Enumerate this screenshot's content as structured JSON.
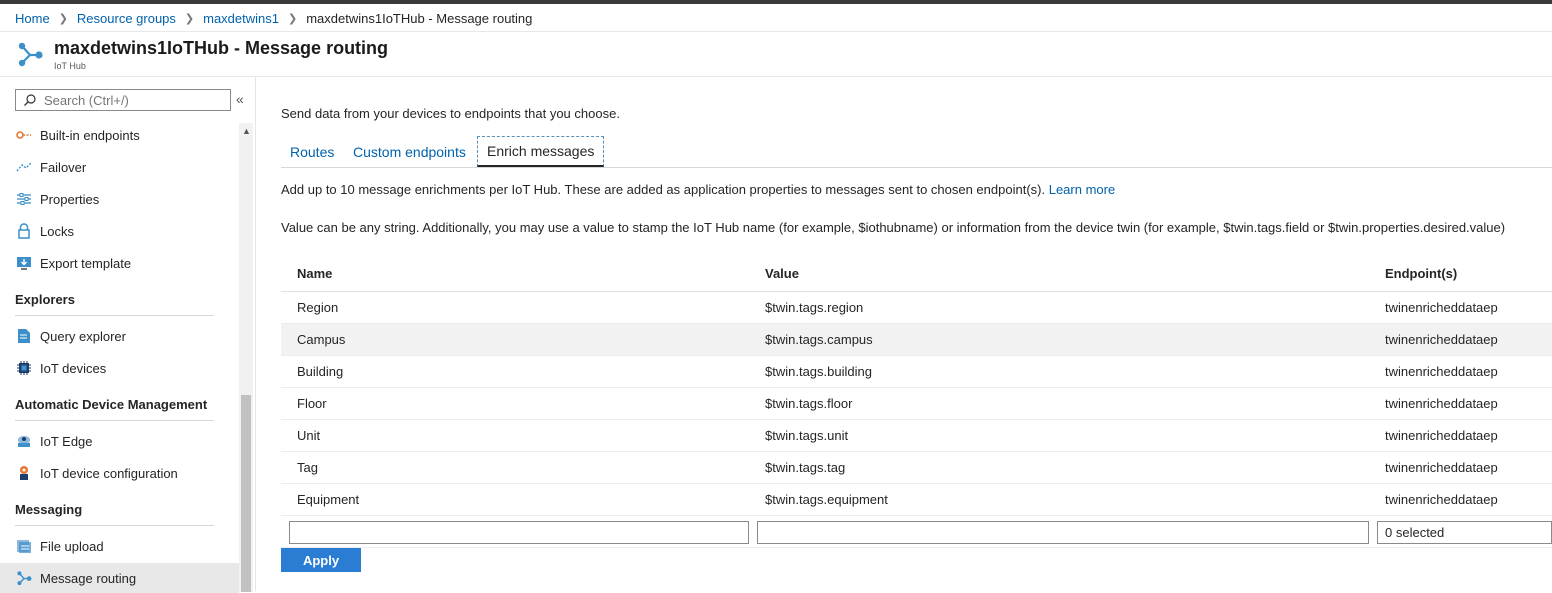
{
  "breadcrumb": {
    "items": [
      "Home",
      "Resource groups",
      "maxdetwins1"
    ],
    "current": "maxdetwins1IoTHub - Message routing"
  },
  "header": {
    "title": "maxdetwins1IoTHub - Message routing",
    "subtitle": "IoT Hub"
  },
  "sidebar": {
    "search_placeholder": "Search (Ctrl+/)",
    "items": [
      {
        "label": "Built-in endpoints",
        "icon": "endpoint-icon"
      },
      {
        "label": "Failover",
        "icon": "failover-icon"
      },
      {
        "label": "Properties",
        "icon": "properties-icon"
      },
      {
        "label": "Locks",
        "icon": "lock-icon"
      },
      {
        "label": "Export template",
        "icon": "export-template-icon"
      }
    ],
    "sections": [
      {
        "title": "Explorers",
        "items": [
          {
            "label": "Query explorer",
            "icon": "query-explorer-icon"
          },
          {
            "label": "IoT devices",
            "icon": "iot-devices-icon"
          }
        ]
      },
      {
        "title": "Automatic Device Management",
        "items": [
          {
            "label": "IoT Edge",
            "icon": "iot-edge-icon"
          },
          {
            "label": "IoT device configuration",
            "icon": "device-configuration-icon"
          }
        ]
      },
      {
        "title": "Messaging",
        "items": [
          {
            "label": "File upload",
            "icon": "file-upload-icon"
          },
          {
            "label": "Message routing",
            "icon": "message-routing-icon"
          }
        ]
      }
    ]
  },
  "main": {
    "intro": "Send data from your devices to endpoints that you choose.",
    "tabs": [
      "Routes",
      "Custom endpoints",
      "Enrich messages"
    ],
    "active_tab": "Enrich messages",
    "desc1": "Add up to 10 message enrichments per IoT Hub. These are added as application properties to messages sent to chosen endpoint(s).",
    "learn_more": "Learn more",
    "desc2": "Value can be any string. Additionally, you may use a value to stamp the IoT Hub name (for example, $iothubname) or information from the device twin (for example, $twin.tags.field or $twin.properties.desired.value)",
    "table": {
      "headers": [
        "Name",
        "Value",
        "Endpoint(s)"
      ],
      "rows": [
        [
          "Region",
          "$twin.tags.region",
          "twinenricheddataep"
        ],
        [
          "Campus",
          "$twin.tags.campus",
          "twinenricheddataep"
        ],
        [
          "Building",
          "$twin.tags.building",
          "twinenricheddataep"
        ],
        [
          "Floor",
          "$twin.tags.floor",
          "twinenricheddataep"
        ],
        [
          "Unit",
          "$twin.tags.unit",
          "twinenricheddataep"
        ],
        [
          "Tag",
          "$twin.tags.tag",
          "twinenricheddataep"
        ],
        [
          "Equipment",
          "$twin.tags.equipment",
          "twinenricheddataep"
        ]
      ]
    },
    "new_row": {
      "name": "",
      "value": "",
      "endpoints": "0 selected"
    },
    "apply_label": "Apply"
  },
  "colors": {
    "accent": "#0062ad",
    "apply_button": "#2b7cd3",
    "alt_row": "#f2f2f2"
  }
}
